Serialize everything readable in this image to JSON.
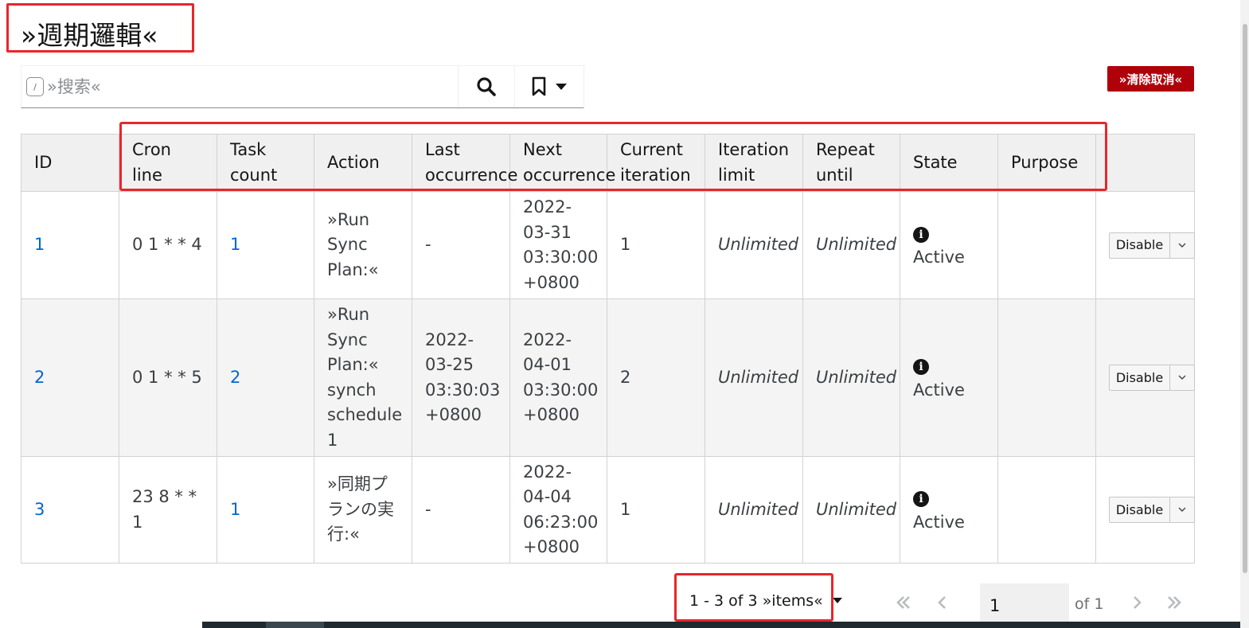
{
  "page": {
    "title": "»週期邏輯«"
  },
  "search": {
    "shortcut": "/",
    "placeholder": "»搜索«"
  },
  "clear_button": "»清除取消«",
  "table": {
    "columns": [
      {
        "l1": "ID",
        "l2": ""
      },
      {
        "l1": "Cron line",
        "l2": ""
      },
      {
        "l1": "Task",
        "l2": "count"
      },
      {
        "l1": "Action",
        "l2": ""
      },
      {
        "l1": "Last",
        "l2": "occurrence"
      },
      {
        "l1": "Next",
        "l2": "occurrence"
      },
      {
        "l1": "Current",
        "l2": "iteration"
      },
      {
        "l1": "Iteration",
        "l2": "limit"
      },
      {
        "l1": "Repeat",
        "l2": "until"
      },
      {
        "l1": "State",
        "l2": ""
      },
      {
        "l1": "Purpose",
        "l2": ""
      }
    ],
    "rows": [
      {
        "id": "1",
        "cron": "0 1 * * 4",
        "task_count": "1",
        "action": [
          "»Run",
          "Sync",
          "Plan:«"
        ],
        "last": [
          "-"
        ],
        "next": [
          "2022-",
          "03-31",
          "03:30:00",
          "+0800"
        ],
        "current_iteration": "1",
        "iteration_limit": "Unlimited",
        "repeat_until": "Unlimited",
        "state": "Active",
        "purpose": "",
        "button": "Disable"
      },
      {
        "id": "2",
        "cron": "0 1 * * 5",
        "task_count": "2",
        "action": [
          "»Run",
          "Sync",
          "Plan:«",
          "synch",
          "schedule",
          "1"
        ],
        "last": [
          "2022-",
          "03-25",
          "03:30:03",
          "+0800"
        ],
        "next": [
          "2022-",
          "04-01",
          "03:30:00",
          "+0800"
        ],
        "current_iteration": "2",
        "iteration_limit": "Unlimited",
        "repeat_until": "Unlimited",
        "state": "Active",
        "purpose": "",
        "button": "Disable"
      },
      {
        "id": "3",
        "cron": "23 8 * * 1",
        "task_count": "1",
        "action": [
          "»同期プ",
          "ランの実",
          "行:«"
        ],
        "last": [
          "-"
        ],
        "next": [
          "2022-",
          "04-04",
          "06:23:00",
          "+0800"
        ],
        "current_iteration": "1",
        "iteration_limit": "Unlimited",
        "repeat_until": "Unlimited",
        "state": "Active",
        "purpose": "",
        "button": "Disable"
      }
    ]
  },
  "pagination": {
    "range": "1 - 3",
    "of_word": "of",
    "total": "3",
    "items_label": "»items«",
    "current_page": "1",
    "of_pages": "of 1"
  },
  "icons": {
    "search": "search-icon",
    "bookmark": "bookmark-icon",
    "info": "info-circle-icon"
  },
  "colors": {
    "accent_red": "#b0000a",
    "link_blue": "#0066cc",
    "highlight_red": "#e8262b"
  }
}
